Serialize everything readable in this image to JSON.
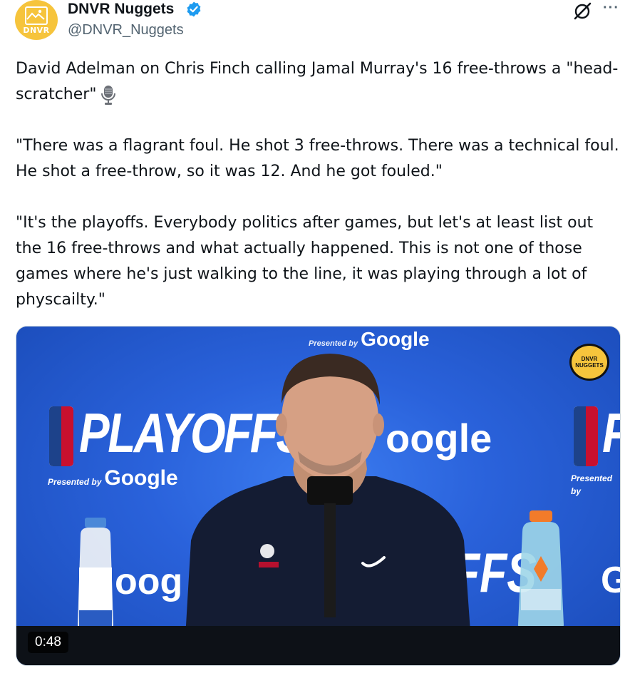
{
  "author": {
    "name": "DNVR Nuggets",
    "handle": "@DNVR_Nuggets",
    "avatar_text": "DNVR",
    "verified": true,
    "verified_color": "#1d9bf0",
    "avatar_color": "#f6c43c"
  },
  "icons": {
    "grok": "grok-icon",
    "more": "more-icon",
    "more_glyph": "···",
    "mic": "microphone-icon"
  },
  "tweet": {
    "paragraphs": [
      "David Adelman on Chris Finch calling Jamal Murray's 16 free-throws a \"head-scratcher\"",
      "\"There was a flagrant foul. He shot 3 free-throws. There was a technical foul. He shot a free-throw, so it was 12. And he got fouled.\"",
      "\"It's the playoffs. Everybody politics after games, but let's at least list out the 16 free-throws and what actually happened. This is not one of those games where he's just walking to the line, it was playing through a lot of physcailty.\""
    ]
  },
  "media": {
    "type": "video",
    "duration": "0:48",
    "backdrop": {
      "presented_by": "Presented by",
      "sponsor": "Google",
      "playoffs": "PLAYOFFS",
      "partial_sponsor": "oogle",
      "partial_sponsor_2": "oog",
      "partial_playoffs": "FFS",
      "edge_letter": "P",
      "edge_letter_2": "G",
      "presented_by_short": "Presented by",
      "badge_text": "DNVR NUGGETS"
    },
    "colors": {
      "backdrop": "#2a62db",
      "shirt": "#141c33"
    }
  }
}
